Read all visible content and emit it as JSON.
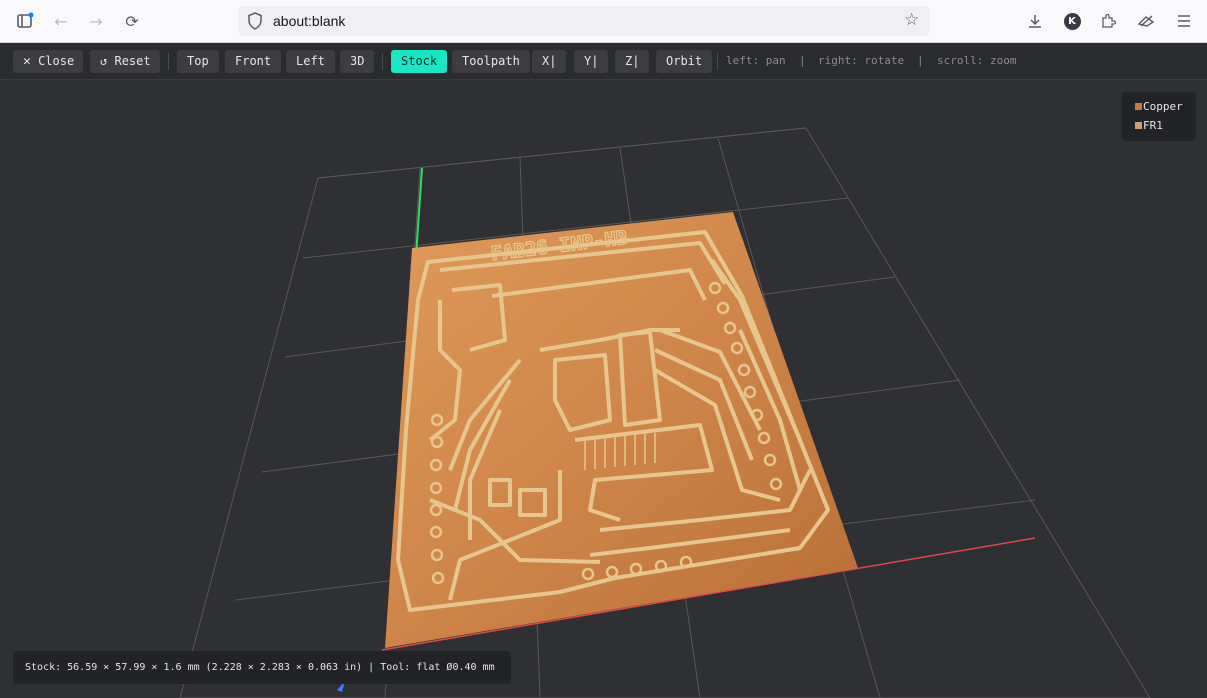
{
  "browser": {
    "url": "about:blank",
    "profile_initial": "K"
  },
  "toolbar": {
    "close_label": "Close",
    "reset_label": "Reset",
    "views": [
      "Top",
      "Front",
      "Left",
      "3D"
    ],
    "modes": [
      "Stock",
      "Toolpath"
    ],
    "active_mode": "Stock",
    "axes": [
      "X|",
      "Y|",
      "Z|"
    ],
    "orbit_label": "Orbit",
    "hints": [
      "left: pan",
      "|",
      "right: rotate",
      "|",
      "scroll: zoom"
    ]
  },
  "board": {
    "silkscreen_text": "FAB26 INP-HB"
  },
  "legend": {
    "items": [
      {
        "label": "Copper",
        "color": "#c8783a"
      },
      {
        "label": "FR1",
        "color": "#c9a27a"
      }
    ]
  },
  "status": {
    "text": "Stock: 56.59 × 57.99 × 1.6 mm (2.228 × 2.283 × 0.063 in) | Tool: flat Ø0.40 mm"
  },
  "colors": {
    "accent": "#18e7c6",
    "copper": "#d0864b",
    "trace": "#e3c38a",
    "grid": "#5a5b60",
    "background": "#2f3033"
  }
}
